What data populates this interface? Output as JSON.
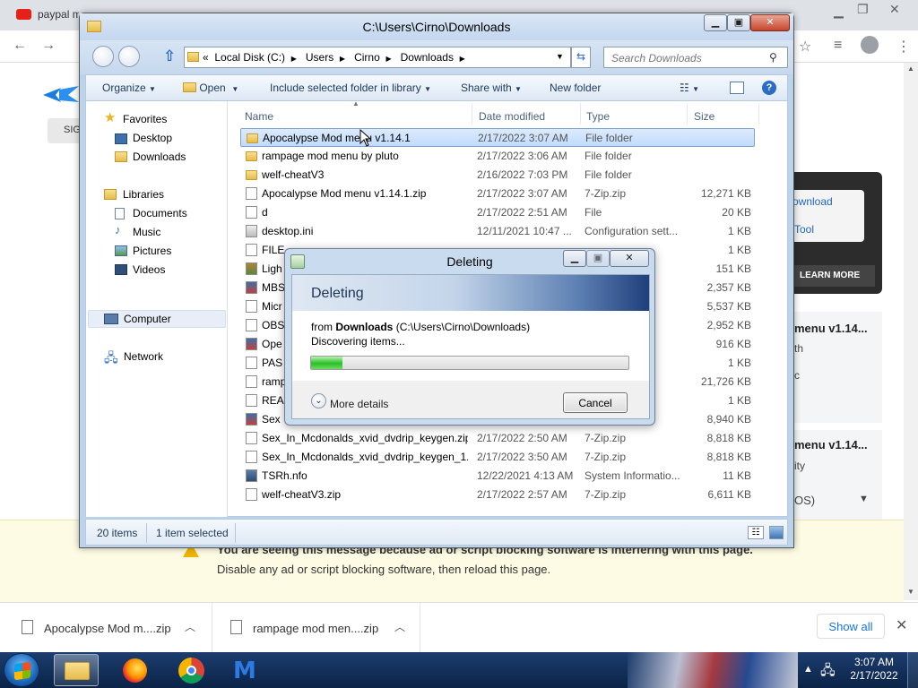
{
  "chrome": {
    "tabs": [
      {
        "title": "paypal m",
        "icon_color": "#e62117"
      }
    ],
    "window_controls": [
      "minimize",
      "restore",
      "close"
    ],
    "toolbar_icons": [
      "back-icon",
      "forward-icon",
      "star-icon",
      "reading-list-icon",
      "profile-icon",
      "menu-icon"
    ]
  },
  "website": {
    "button_label": "SIG",
    "ad_panel": {
      "link1": "ownload",
      "link2": "Tool",
      "learn_more": "LEARN MORE"
    },
    "side_cards": [
      {
        "title": "menu v1.14...",
        "sub": "th",
        "sub2": "c"
      },
      {
        "title": "menu v1.14...",
        "sub": "ity",
        "select": "OS)"
      }
    ],
    "adblock_banner": {
      "line1": "You are seeing this message because ad or script blocking software is interfering with this page.",
      "line2": "Disable any ad or script blocking software, then reload this page."
    }
  },
  "downloads_shelf": {
    "items": [
      {
        "name": "Apocalypse Mod m....zip"
      },
      {
        "name": "rampage mod men....zip"
      }
    ],
    "show_all": "Show all"
  },
  "explorer": {
    "title": "C:\\Users\\Cirno\\Downloads",
    "address": {
      "prefix": "«",
      "segments": [
        "Local Disk (C:)",
        "Users",
        "Cirno",
        "Downloads"
      ]
    },
    "search_placeholder": "Search Downloads",
    "commands": {
      "organize": "Organize",
      "open": "Open",
      "include": "Include selected folder in library",
      "share": "Share with",
      "new_folder": "New folder"
    },
    "nav": {
      "favorites": "Favorites",
      "desktop": "Desktop",
      "downloads": "Downloads",
      "libraries": "Libraries",
      "documents": "Documents",
      "music": "Music",
      "pictures": "Pictures",
      "videos": "Videos",
      "computer": "Computer",
      "network": "Network"
    },
    "columns": {
      "name": "Name",
      "date": "Date modified",
      "type": "Type",
      "size": "Size"
    },
    "files": [
      {
        "name": "Apocalypse Mod menu v1.14.1",
        "date": "2/17/2022 3:07 AM",
        "type": "File folder",
        "size": "",
        "icon": "folder",
        "selected": true
      },
      {
        "name": "rampage mod menu by pluto",
        "date": "2/17/2022 3:06 AM",
        "type": "File folder",
        "size": "",
        "icon": "folder",
        "selected": false
      },
      {
        "name": "welf-cheatV3",
        "date": "2/16/2022 7:03 PM",
        "type": "File folder",
        "size": "",
        "icon": "folder",
        "selected": false
      },
      {
        "name": "Apocalypse Mod menu v1.14.1.zip",
        "date": "2/17/2022 3:07 AM",
        "type": "7-Zip.zip",
        "size": "12,271 KB",
        "icon": "zip",
        "selected": false
      },
      {
        "name": "d",
        "date": "2/17/2022 2:51 AM",
        "type": "File",
        "size": "20 KB",
        "icon": "doc",
        "selected": false
      },
      {
        "name": "desktop.ini",
        "date": "12/11/2021 10:47 ...",
        "type": "Configuration sett...",
        "size": "1 KB",
        "icon": "ini",
        "selected": false
      },
      {
        "name": "FILE",
        "date": "",
        "type": "",
        "size": "1 KB",
        "icon": "doc",
        "selected": false
      },
      {
        "name": "Ligh",
        "date": "",
        "type": "",
        "size": "151 KB",
        "icon": "img",
        "selected": false
      },
      {
        "name": "MBS",
        "date": "",
        "type": "",
        "size": "2,357 KB",
        "icon": "app",
        "selected": false
      },
      {
        "name": "Micr",
        "date": "",
        "type": "",
        "size": "5,537 KB",
        "icon": "doc",
        "selected": false
      },
      {
        "name": "OBS",
        "date": "",
        "type": "",
        "size": "2,952 KB",
        "icon": "doc",
        "selected": false
      },
      {
        "name": "Ope",
        "date": "",
        "type": "",
        "size": "916 KB",
        "icon": "app",
        "selected": false
      },
      {
        "name": "PAS",
        "date": "",
        "type": "",
        "size": "1 KB",
        "icon": "doc",
        "selected": false
      },
      {
        "name": "ramp",
        "date": "",
        "type": "",
        "size": "21,726 KB",
        "icon": "doc",
        "selected": false
      },
      {
        "name": "REA",
        "date": "",
        "type": "",
        "size": "1 KB",
        "icon": "doc",
        "selected": false
      },
      {
        "name": "Sex",
        "date": "",
        "type": "",
        "size": "8,940 KB",
        "icon": "app",
        "selected": false
      },
      {
        "name": "Sex_In_Mcdonalds_xvid_dvdrip_keygen.zip",
        "date": "2/17/2022 2:50 AM",
        "type": "7-Zip.zip",
        "size": "8,818 KB",
        "icon": "zip",
        "selected": false
      },
      {
        "name": "Sex_In_Mcdonalds_xvid_dvdrip_keygen_1...",
        "date": "2/17/2022 3:50 AM",
        "type": "7-Zip.zip",
        "size": "8,818 KB",
        "icon": "zip",
        "selected": false
      },
      {
        "name": "TSRh.nfo",
        "date": "12/22/2021 4:13 AM",
        "type": "System Informatio...",
        "size": "11 KB",
        "icon": "nfo",
        "selected": false
      },
      {
        "name": "welf-cheatV3.zip",
        "date": "2/17/2022 2:57 AM",
        "type": "7-Zip.zip",
        "size": "6,611 KB",
        "icon": "zip",
        "selected": false
      }
    ],
    "status": {
      "count": "20 items",
      "selected": "1 item selected"
    }
  },
  "dialog": {
    "title": "Deleting",
    "heading": "Deleting",
    "from_label": "from ",
    "from_folder": "Downloads",
    "from_path": " (C:\\Users\\Cirno\\Downloads)",
    "status": "Discovering items...",
    "progress": 0.1,
    "more_details": "More details",
    "cancel": "Cancel"
  },
  "taskbar": {
    "time": "3:07 AM",
    "date": "2/17/2022",
    "apps": [
      "explorer-icon",
      "firefox-icon",
      "chrome-icon",
      "malwarebytes-icon"
    ]
  }
}
